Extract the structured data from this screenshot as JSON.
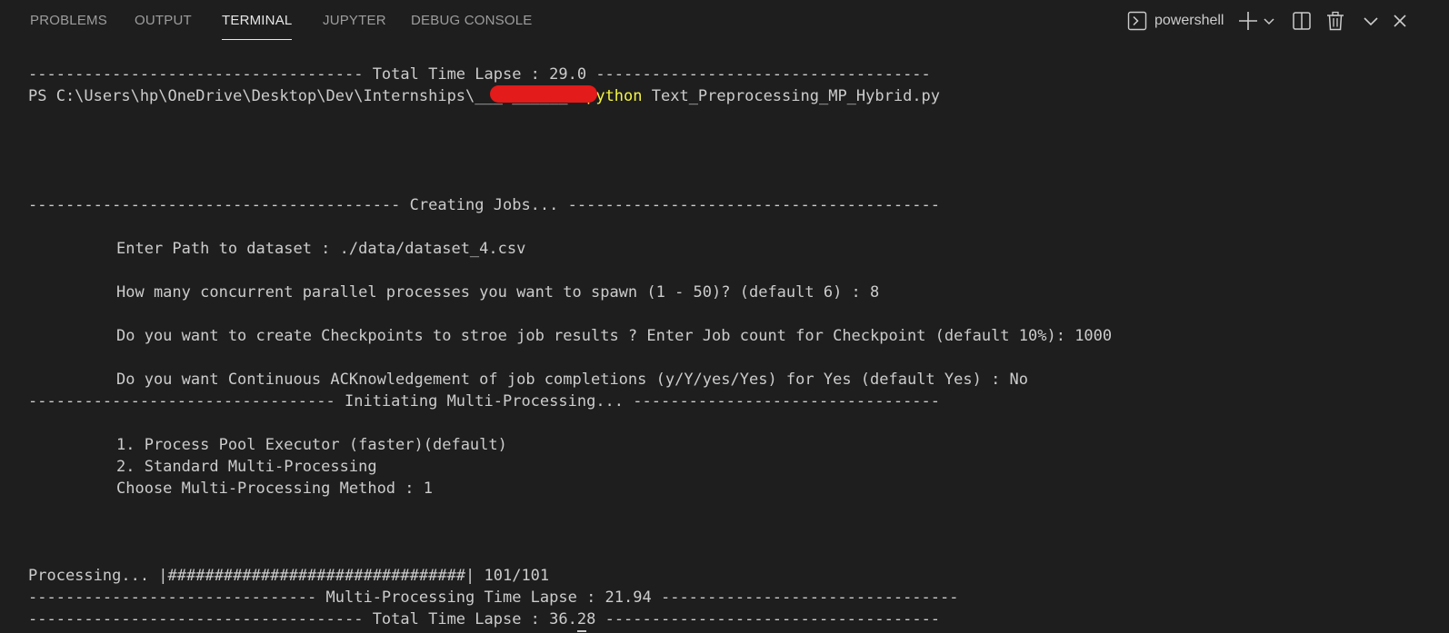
{
  "tabs": [
    {
      "label": "PROBLEMS",
      "active": false
    },
    {
      "label": "OUTPUT",
      "active": false
    },
    {
      "label": "TERMINAL",
      "active": true
    },
    {
      "label": "JUPYTER",
      "active": false
    },
    {
      "label": "DEBUG CONSOLE",
      "active": false
    }
  ],
  "toolbar": {
    "shell_name": "powershell",
    "icons": [
      "terminal-icon",
      "plus-icon",
      "chevron-down-icon",
      "split-icon",
      "trash-icon",
      "chevron-down-icon",
      "close-icon"
    ]
  },
  "colors": {
    "background": "#1e1e1e",
    "text": "#cccccc",
    "command": "#f5f543",
    "redaction": "#e31b1b"
  },
  "terminal": {
    "line_total_time_1": "------------------------------------ Total Time Lapse : 29.0 ------------------------------------",
    "prompt_path": "PS C:\\Users\\hp\\OneDrive\\Desktop\\Dev\\Internships\\___ ______> ",
    "prompt_command": "python",
    "prompt_args": " Text_Preprocessing_MP_Hybrid.py",
    "line_creating_jobs": "---------------------------------------- Creating Jobs... ----------------------------------------",
    "line_path": "Enter Path to dataset : ./data/dataset_4.csv",
    "line_processes": "How many concurrent parallel processes you want to spawn (1 - 50)? (default 6) : 8",
    "line_checkpoints": "Do you want to create Checkpoints to stroe job results ? Enter Job count for Checkpoint (default 10%): 1000",
    "line_ack": "Do you want Continuous ACKnowledgement of job completions (y/Y/yes/Yes) for Yes (default Yes) : No",
    "line_initiating": "--------------------------------- Initiating Multi-Processing... ---------------------------------",
    "line_option_1": "1. Process Pool Executor (faster)(default)",
    "line_option_2": "2. Standard Multi-Processing",
    "line_choose": "Choose Multi-Processing Method : 1",
    "line_processing": "Processing... |################################| 101/101",
    "line_mp_time": "------------------------------- Multi-Processing Time Lapse : 21.94 --------------------------------",
    "line_total_time_2_a": "------------------------------------ Total Time Lapse : 36.",
    "line_total_time_2_b": "2",
    "line_total_time_2_c": "8 ------------------------------------"
  }
}
